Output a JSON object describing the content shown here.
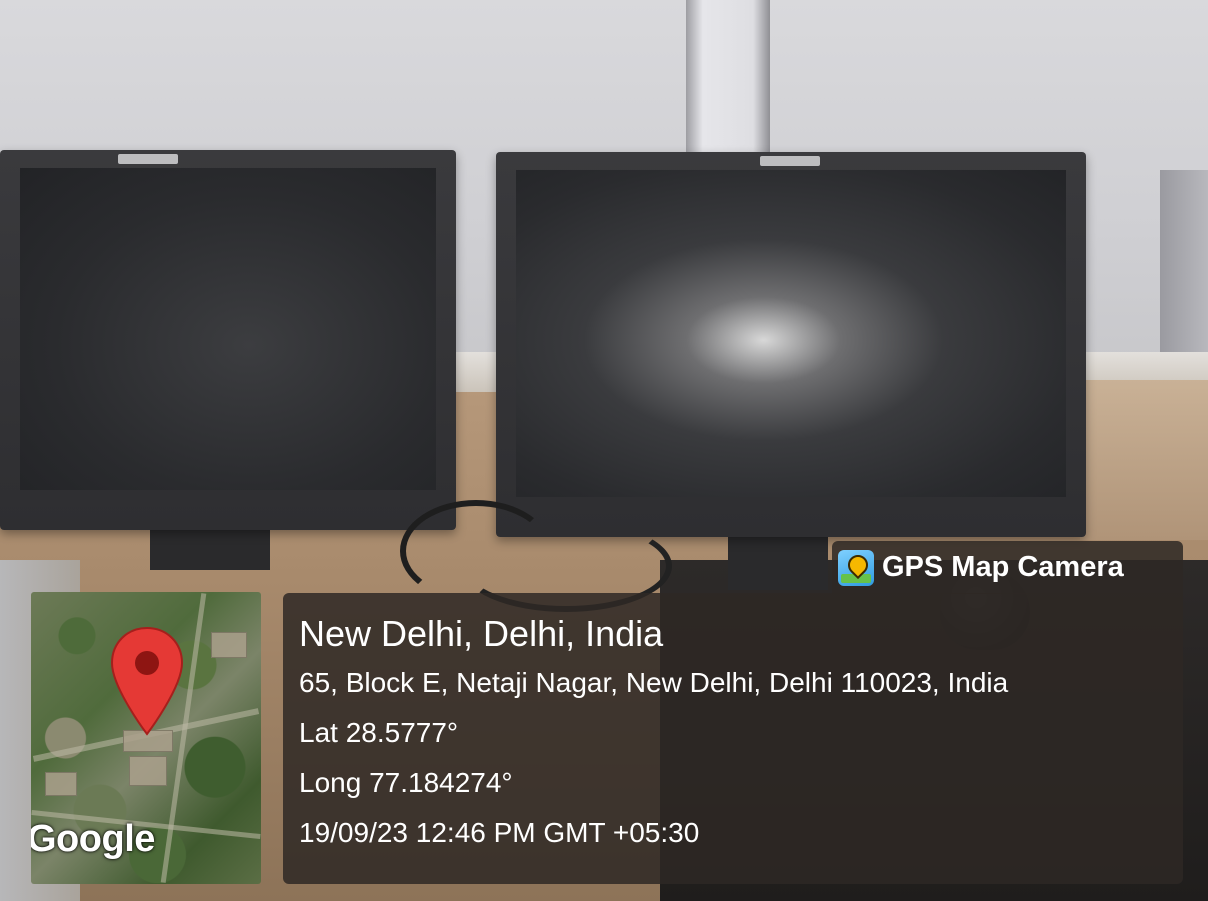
{
  "overlay": {
    "brand": {
      "label": "GPS Map Camera",
      "icon": "gps-map-camera-app-icon"
    },
    "location": {
      "title": "New Delhi, Delhi, India",
      "address": "65, Block E, Netaji Nagar, New Delhi, Delhi 110023, India",
      "latitude": "Lat 28.5777°",
      "longitude": "Long 77.184274°",
      "datetime": "19/09/23 12:46 PM GMT +05:30"
    },
    "map": {
      "attribution": "Google",
      "pin_icon": "map-pin-icon",
      "pin_color": "#e53935"
    },
    "panel_color": "#2e2824"
  }
}
